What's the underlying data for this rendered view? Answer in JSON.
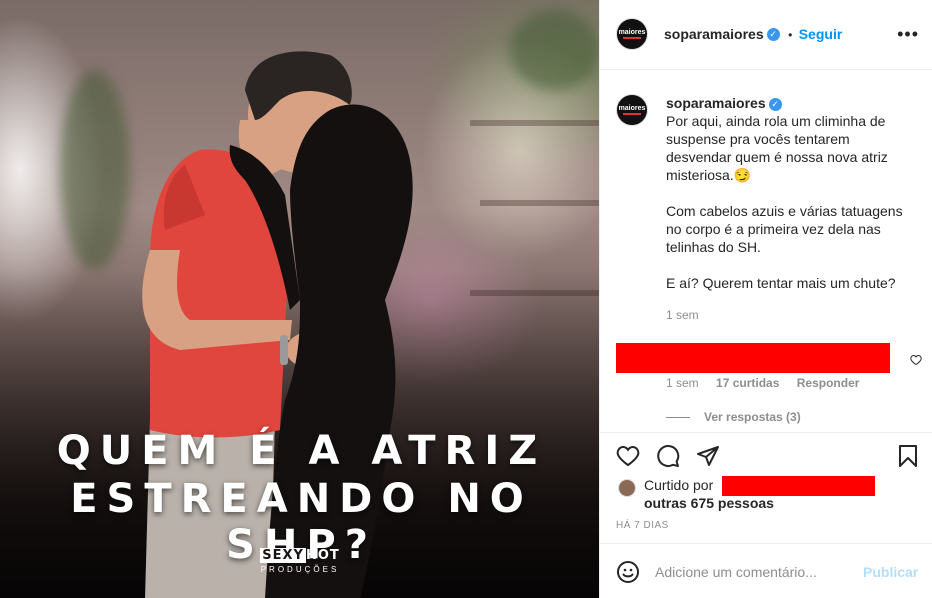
{
  "post": {
    "headline_line1": "QUEM É A ATRIZ",
    "headline_line2": "ESTREANDO NO SHP?",
    "brand_sexy": "SEXY",
    "brand_hot": "HOT",
    "brand_sub": "PRODUÇÕES"
  },
  "header": {
    "avatar_text": "maiores",
    "username": "soparamaiores",
    "separator": "•",
    "follow_label": "Seguir",
    "more_label": "•••"
  },
  "caption": {
    "username": "soparamaiores",
    "p1": "Por aqui, ainda rola um climinha de suspense pra vocês tentarem desvendar quem é nossa nova atriz misteriosa.😏",
    "p2": "Com cabelos azuis e várias tatuagens no corpo é a primeira vez dela nas telinhas do SH.",
    "p3": "E aí? Querem tentar mais um chute?",
    "time": "1 sem"
  },
  "comment": {
    "time": "1 sem",
    "likes": "17 curtidas",
    "reply": "Responder",
    "view_replies": "Ver respostas (3)"
  },
  "likes": {
    "prefix": "Curtido por",
    "others": "outras 675 pessoas"
  },
  "date": "HÁ 7 DIAS",
  "add_comment": {
    "placeholder": "Adicione um comentário...",
    "publish": "Publicar"
  },
  "colors": {
    "accent": "#0095f6",
    "verified": "#3897f0",
    "redaction": "#ff0000",
    "muted": "#8e8e8e"
  }
}
